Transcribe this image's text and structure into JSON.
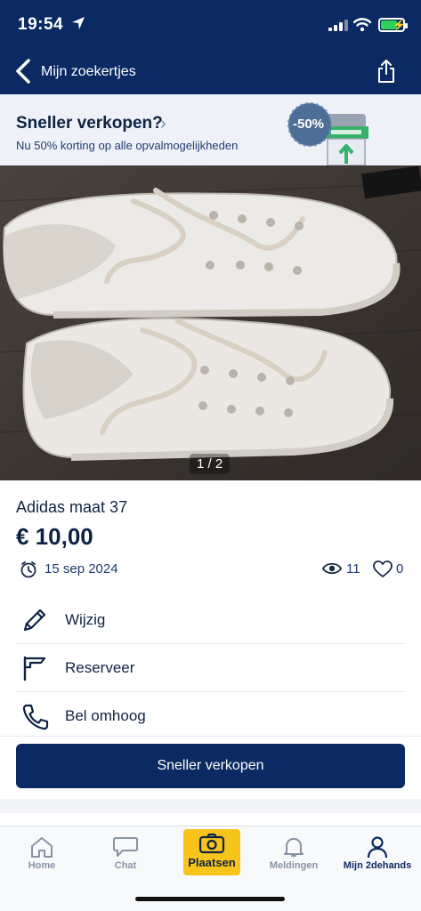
{
  "status": {
    "time": "19:54"
  },
  "nav": {
    "back_label": "Mijn zoekertjes"
  },
  "promo": {
    "title": "Sneller verkopen?",
    "subtitle": "Nu 50% korting op alle opvalmogelijkheden",
    "badge": "-50%"
  },
  "gallery": {
    "counter": "1 / 2"
  },
  "listing": {
    "title": "Adidas maat 37",
    "price": "€ 10,00",
    "date": "15 sep 2024",
    "views": "11",
    "likes": "0"
  },
  "actions": [
    {
      "label": "Wijzig",
      "icon": "pencil-icon"
    },
    {
      "label": "Reserveer",
      "icon": "flag-icon"
    },
    {
      "label": "Bel omhoog",
      "icon": "phone-icon"
    }
  ],
  "cta": {
    "label": "Sneller verkopen"
  },
  "tabs": [
    {
      "label": "Home",
      "icon": "home-icon"
    },
    {
      "label": "Chat",
      "icon": "chat-icon"
    },
    {
      "label": "Plaatsen",
      "icon": "camera-icon"
    },
    {
      "label": "Meldingen",
      "icon": "bell-icon"
    },
    {
      "label": "Mijn 2dehands",
      "icon": "user-icon"
    }
  ],
  "colors": {
    "brand": "#0b2a63",
    "accent": "#f7c41c",
    "promo_bg": "#eef1f7",
    "badge": "#4d6e96"
  }
}
